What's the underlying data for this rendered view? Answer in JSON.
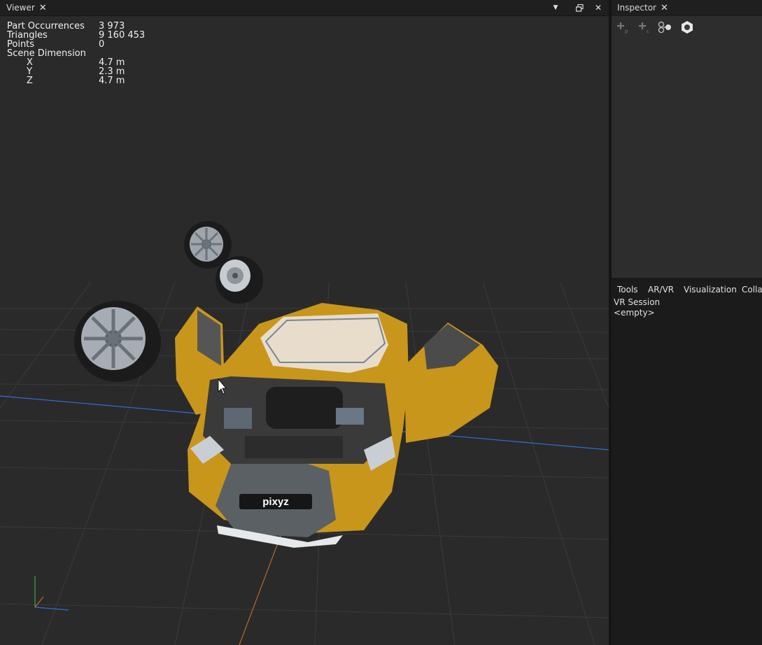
{
  "viewer": {
    "tab_label": "Viewer",
    "close_glyph": "✕",
    "menu_glyph": "▼",
    "float_glyph": "⧉",
    "panel_close_glyph": "✕",
    "stats": [
      {
        "label": "Part Occurrences",
        "value": "3 973",
        "indent": false
      },
      {
        "label": "Triangles",
        "value": "9 160 453",
        "indent": false
      },
      {
        "label": "Points",
        "value": "0",
        "indent": false
      },
      {
        "label": "Scene Dimension",
        "value": "",
        "indent": false
      },
      {
        "label": "X",
        "value": "4.7 m",
        "indent": true
      },
      {
        "label": "Y",
        "value": "2.3 m",
        "indent": true
      },
      {
        "label": "Z",
        "value": "4.7 m",
        "indent": true
      }
    ],
    "car_badge": "pixyz",
    "colors": {
      "background": "#2a2a2a",
      "grid": "#3a3a3a",
      "x_axis": "#2f6fd8",
      "z_axis": "#b86a2a",
      "car_body": "#c8961a"
    }
  },
  "inspector": {
    "tab_label": "Inspector",
    "close_glyph": "✕",
    "tools": [
      {
        "name": "add-property-icon"
      },
      {
        "name": "add-component-icon"
      },
      {
        "name": "link-components-icon"
      },
      {
        "name": "material-icon"
      }
    ]
  },
  "bottom_panel": {
    "tabs": [
      "Tools",
      "AR/VR",
      "Visualization",
      "Collab"
    ],
    "session_label": "VR Session",
    "session_value": "<empty>"
  }
}
